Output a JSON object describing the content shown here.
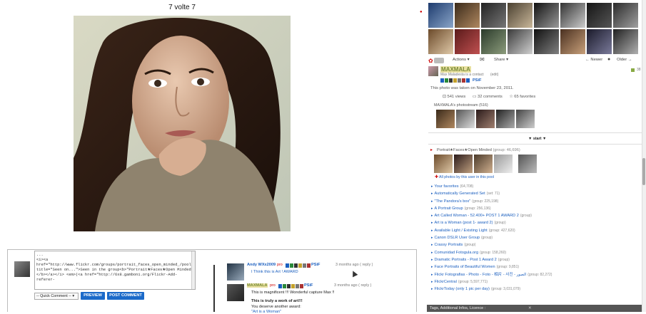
{
  "page_title": "7 volte 7",
  "comment_form": {
    "textarea_value": "...\n<i><a href=\"http://www.flickr.com/groups/portrait_faces_open_minded_/pool/\"\ntitle=\"Seen on...\">Seen in the group<b>\"Portrait★Faces★Open Minded\"\n</b></a></i> <em>(<a href=\"http://6x8.gamboni.org/Flickr-Add-referer-",
    "quick_comment": "-- Quick Comment -- ▾",
    "preview_label": "PREVIEW",
    "post_label": "POST COMMENT"
  },
  "comments": [
    {
      "author": "Andy WXx2009",
      "pro": "pro",
      "meta": "3 months ago ( reply )",
      "text": "I Think this is Art ! AWARD"
    },
    {
      "author": "MAXMALA",
      "pro": "pro",
      "meta": "3 months ago ( reply )",
      "text1": "This is magnificent !!! Wonderful capture Max !!",
      "text2": "This is truly a work of art!!!",
      "text3": "You deserve another award:",
      "link": "\"Art is a Woman\""
    }
  ],
  "psif_label": "PSiF",
  "toolbar": {
    "actions": "Actions ▾",
    "share": "Share ▾",
    "newer": "← Newer",
    "older": "Older →"
  },
  "owner": {
    "name": "MAXMALA",
    "sub": "Max Maladesta is a contact",
    "edit": "(edit)",
    "side": "38"
  },
  "taken": "This photo was taken on November 23, 2011.",
  "stats": {
    "views": "541 views",
    "comments": "32 comments",
    "favorites": "65 favorites"
  },
  "stream_label": "MAXMALA's photostream (516)",
  "start_label": "▼ start ▼",
  "group": {
    "name": "Portrait★Faces★Open Minded",
    "count": "(group: 46,696)",
    "all_photos": "All photos by this user in this pool"
  },
  "pools": [
    {
      "name": "Your favorites",
      "count": "(64,708)"
    },
    {
      "name": "Automatically Generated Set",
      "count": "(set: 71)"
    },
    {
      "name": "\"The Pandora's box\"",
      "count": "(group: 225,198)"
    },
    {
      "name": "A Portrait Group",
      "count": "(group: 256,136)"
    },
    {
      "name": "Art Called Woman - 52.400+ POST 1 AWARD 2",
      "count": "(group)"
    },
    {
      "name": "Art is a Woman (post 1- award 2)",
      "count": "(group)"
    },
    {
      "name": "Available Light / Existing Light",
      "count": "(group: 427,620)"
    },
    {
      "name": "Canon DSLR User Group",
      "count": "(group)"
    },
    {
      "name": "Crassy Portraits",
      "count": "(group)"
    },
    {
      "name": "Comunidad Fotogula.org",
      "count": "(group: 158,260)"
    },
    {
      "name": "Dramatic Portraits - Post 1 Award 2",
      "count": "(group)"
    },
    {
      "name": "Face Portraits of Beautiful Women",
      "count": "(group: 9,851)"
    },
    {
      "name": "Flickr Fotografias - Photo - Foto - 相片 - 사진 - الصور",
      "count": "(group: 82,272)"
    },
    {
      "name": "FlickrCentral",
      "count": "(group: 5,597,771)"
    },
    {
      "name": "FlickrToday (only 1 pic per day)",
      "count": "(group: 3,031,079)"
    }
  ],
  "tags_bar": "Tags, Additional Infos, Licence :"
}
